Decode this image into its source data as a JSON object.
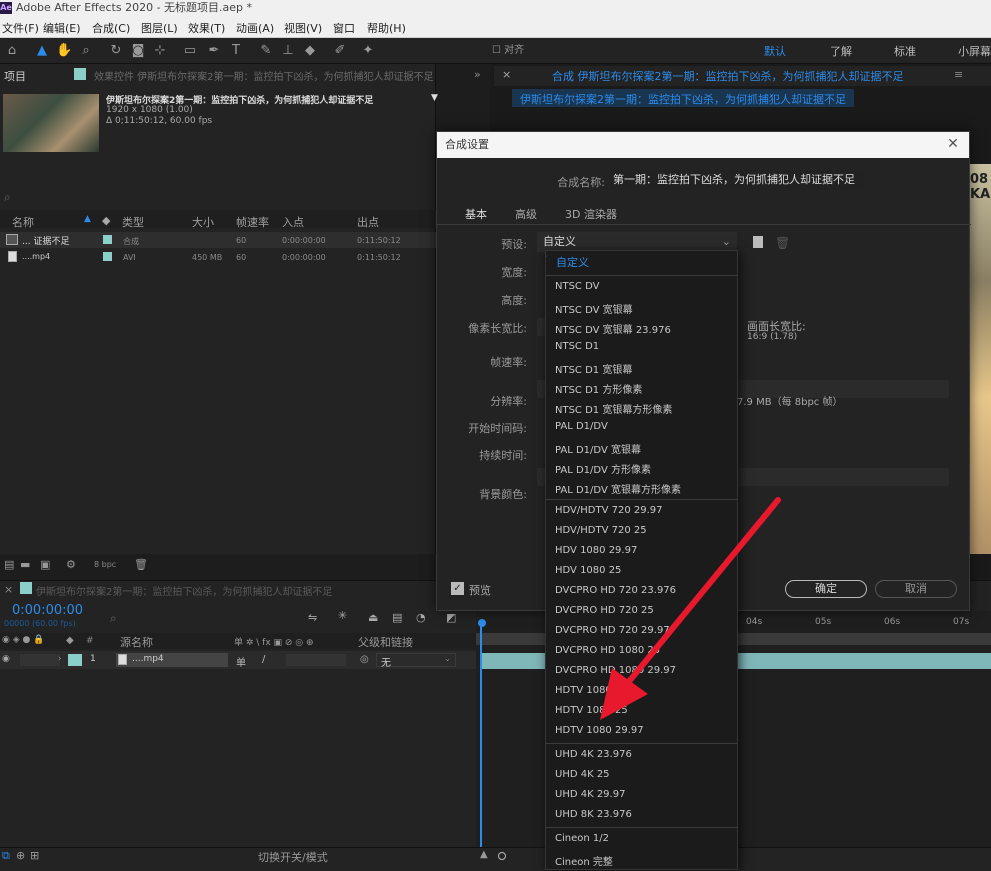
{
  "app": {
    "title": "Adobe After Effects 2020 - 无标题项目.aep *",
    "logo": "Ae"
  },
  "menu": [
    "文件(F)",
    "编辑(E)",
    "合成(C)",
    "图层(L)",
    "效果(T)",
    "动画(A)",
    "视图(V)",
    "窗口",
    "帮助(H)"
  ],
  "workspaces": [
    "默认",
    "了解",
    "标准",
    "小屏幕"
  ],
  "project": {
    "tab": "项目",
    "tab2": "效果控件 伊斯坦布尔探案2第一期：监控拍下凶杀，为何抓捕犯人却证据不足",
    "comp_name": "伊斯坦布尔探案2第一期：监控拍下凶杀，为何抓捕犯人却证据不足",
    "comp_size": "1920 x 1080 (1.00)",
    "comp_duration": "Δ 0;11:50:12, 60.00 fps",
    "columns": [
      "名称",
      "类型",
      "大小",
      "帧速率",
      "入点",
      "出点"
    ],
    "rows": [
      {
        "name": "... 证据不足",
        "type": "合成",
        "size": "",
        "fps": "60",
        "in": "0:00:00:00",
        "out": "0:11:50:12"
      },
      {
        "name": "....mp4",
        "type": "AVI",
        "size": "450 MB",
        "fps": "60",
        "in": "0:00:00:00",
        "out": "0:11:50:12"
      }
    ],
    "bpc": "8 bpc"
  },
  "viewer": {
    "tab": "合成 伊斯坦布尔探案2第一期：监控拍下凶杀，为何抓捕犯人却证据不足",
    "breadcrumb": "伊斯坦布尔探案2第一期：监控拍下凶杀，为何抓捕犯人却证据不足",
    "preview_text_1": "08",
    "preview_text_2": "KA"
  },
  "dialog": {
    "title": "合成设置",
    "name_label": "合成名称:",
    "name_value": "第一期：监控拍下凶杀，为何抓捕犯人却证据不足",
    "tabs": [
      "基本",
      "高级",
      "3D 渲染器"
    ],
    "preset_label": "预设:",
    "preset_value": "自定义",
    "width_label": "宽度:",
    "height_label": "高度:",
    "par_label": "像素长宽比:",
    "aspect_label": "画面长宽比:",
    "aspect_value": "16:9 (1.78)",
    "fps_label": "帧速率:",
    "res_label": "分辨率:",
    "res_value": "7.9 MB（每 8bpc 帧）",
    "start_label": "开始时间码:",
    "duration_label": "持续时间:",
    "bg_label": "背景颜色:",
    "preview_label": "预览",
    "ok": "确定",
    "cancel": "取消"
  },
  "dropdown": {
    "selected": "自定义",
    "groups": [
      [
        "NTSC DV",
        "NTSC DV 宽银幕",
        "NTSC DV 宽银幕 23.976",
        "NTSC D1",
        "NTSC D1 宽银幕",
        "NTSC D1 方形像素",
        "NTSC D1 宽银幕方形像素",
        "PAL D1/DV",
        "PAL D1/DV 宽银幕",
        "PAL D1/DV 方形像素",
        "PAL D1/DV 宽银幕方形像素"
      ],
      [
        "HDV/HDTV 720 29.97",
        "HDV/HDTV 720 25",
        "HDV 1080 29.97",
        "HDV 1080 25",
        "DVCPRO HD 720 23.976",
        "DVCPRO HD 720 25",
        "DVCPRO HD 720 29.97",
        "DVCPRO HD 1080 25",
        "DVCPRO HD 1080 29.97",
        "HDTV 1080 24",
        "HDTV 1080 25",
        "HDTV 1080 29.97"
      ],
      [
        "UHD 4K 23.976",
        "UHD 4K 25",
        "UHD 4K 29.97",
        "UHD 8K 23.976"
      ],
      [
        "Cineon 1/2",
        "Cineon 完整"
      ]
    ]
  },
  "timeline": {
    "tab": "伊斯坦布尔探案2第一期：监控拍下凶杀，为何抓捕犯人却证据不足",
    "timecode": "0:00:00:00",
    "fps_note": "00000 (60.00 fps)",
    "col_source": "源名称",
    "col_switches": "单 ✲ \\ fx ▣ ⊘ ◎ ⊕",
    "col_parent": "父级和链接",
    "layer_num": "1",
    "layer_name": "....mp4",
    "parent_value": "无",
    "ruler": [
      "04s",
      "05s",
      "06s",
      "07s"
    ],
    "footer": "切换开关/模式"
  },
  "colors": {
    "accent": "#2d8ceb",
    "arrow": "#e8192c",
    "track": "#7fb6b8"
  }
}
